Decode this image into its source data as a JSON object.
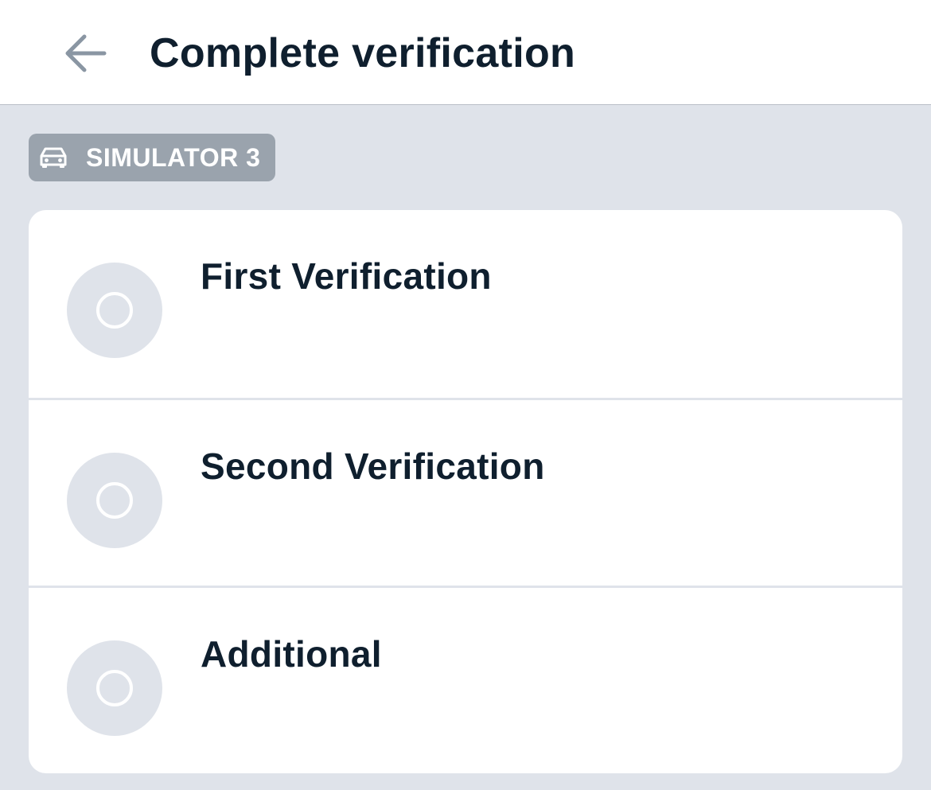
{
  "header": {
    "title": "Complete verification",
    "back_icon": "arrow-left-icon"
  },
  "badge": {
    "icon": "car-icon",
    "label": "SIMULATOR 3"
  },
  "verifications": [
    {
      "label": "First Verification",
      "status_icon": "empty-circle-icon"
    },
    {
      "label": "Second Verification",
      "status_icon": "empty-circle-icon"
    },
    {
      "label": "Additional",
      "status_icon": "empty-circle-icon"
    }
  ],
  "colors": {
    "background": "#dfe3ea",
    "title_text": "#0f1f2e",
    "badge_bg": "#9aa3ad",
    "back_arrow": "#8a96a3"
  }
}
